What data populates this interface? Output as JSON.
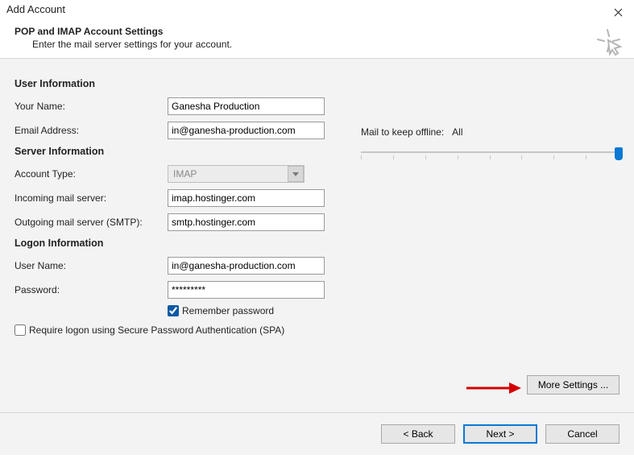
{
  "window": {
    "title": "Add Account",
    "heading": "POP and IMAP Account Settings",
    "subheading": "Enter the mail server settings for your account."
  },
  "sections": {
    "user_info": "User Information",
    "server_info": "Server Information",
    "logon_info": "Logon Information"
  },
  "labels": {
    "your_name": "Your Name:",
    "email": "Email Address:",
    "account_type": "Account Type:",
    "incoming": "Incoming mail server:",
    "outgoing": "Outgoing mail server (SMTP):",
    "username": "User Name:",
    "password": "Password:",
    "remember": "Remember password",
    "spa": "Require logon using Secure Password Authentication (SPA)",
    "mail_offline": "Mail to keep offline:",
    "mail_offline_value": "All"
  },
  "values": {
    "your_name": "Ganesha Production",
    "email": "in@ganesha-production.com",
    "account_type": "IMAP",
    "incoming": "imap.hostinger.com",
    "outgoing": "smtp.hostinger.com",
    "username": "in@ganesha-production.com",
    "password": "*********",
    "remember": true,
    "spa": false
  },
  "buttons": {
    "more": "More Settings ...",
    "back": "< Back",
    "next": "Next >",
    "cancel": "Cancel"
  }
}
